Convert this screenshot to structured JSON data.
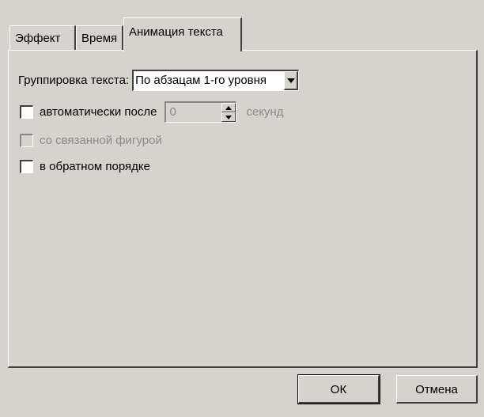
{
  "tabs": [
    {
      "label": "Эффект",
      "active": false
    },
    {
      "label": "Время",
      "active": false
    },
    {
      "label": "Анимация текста",
      "active": true
    }
  ],
  "grouping": {
    "label": "Группировка текста:",
    "selected": "По абзацам 1-го уровня"
  },
  "auto_after": {
    "label": "автоматически после",
    "value": "0",
    "unit": "секунд",
    "checked": false
  },
  "attached_shape": {
    "label": "со связанной фигурой",
    "checked": false,
    "enabled": false
  },
  "reverse_order": {
    "label": "в обратном порядке",
    "checked": false
  },
  "buttons": {
    "ok": "ОК",
    "cancel": "Отмена"
  }
}
